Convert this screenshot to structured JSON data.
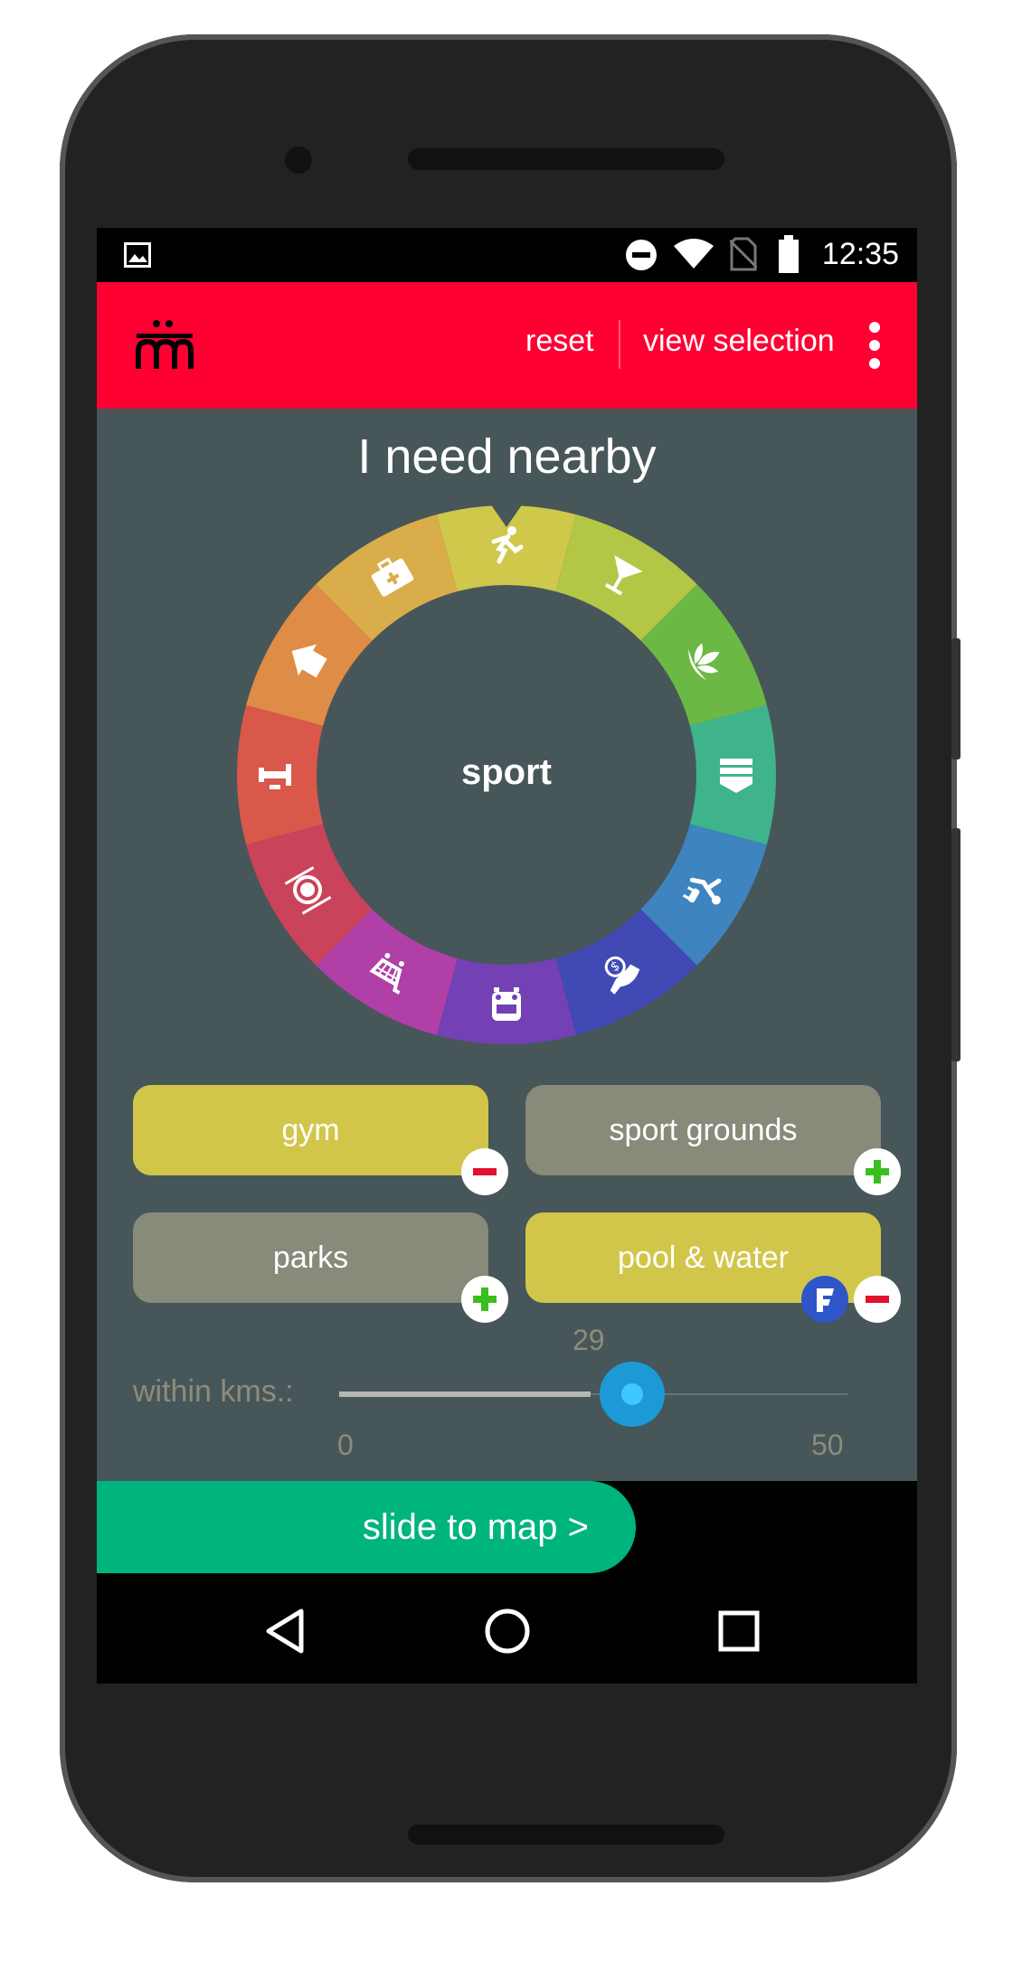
{
  "status_bar": {
    "time": "12:35",
    "icons": [
      "image-icon",
      "do-not-disturb-icon",
      "wifi-icon",
      "no-sim-icon",
      "battery-icon"
    ]
  },
  "app_bar": {
    "logo": "m-logo",
    "reset_label": "reset",
    "view_selection_label": "view selection",
    "more_icon": "more-vert-icon",
    "color": "#ff0033"
  },
  "heading": "I need nearby",
  "wheel": {
    "selected_label": "sport",
    "segments": [
      {
        "name": "sport",
        "icon": "runner-icon",
        "color": "#cfc84a",
        "selected": true
      },
      {
        "name": "drinks",
        "icon": "cocktail-icon",
        "color": "#b4c646"
      },
      {
        "name": "wellness",
        "icon": "lotus-icon",
        "color": "#6bb944"
      },
      {
        "name": "education",
        "icon": "books-icon",
        "color": "#3fb48c"
      },
      {
        "name": "pets",
        "icon": "dog-walker-icon",
        "color": "#3e84bf"
      },
      {
        "name": "money",
        "icon": "money-hand-icon",
        "color": "#4049b4"
      },
      {
        "name": "transport",
        "icon": "bus-icon",
        "color": "#7341b4"
      },
      {
        "name": "shopping",
        "icon": "cart-icon",
        "color": "#b03fa7"
      },
      {
        "name": "food",
        "icon": "plate-icon",
        "color": "#c9435a"
      },
      {
        "name": "fuel",
        "icon": "fuel-icon",
        "color": "#d9584a"
      },
      {
        "name": "home",
        "icon": "house-icon",
        "color": "#df8c46"
      },
      {
        "name": "health",
        "icon": "first-aid-icon",
        "color": "#d8ad4a"
      }
    ]
  },
  "chips": [
    {
      "label": "gym",
      "selected": true
    },
    {
      "label": "sport grounds",
      "selected": false
    },
    {
      "label": "parks",
      "selected": false
    },
    {
      "label": "pool & water",
      "selected": true,
      "foursquare": true
    }
  ],
  "slider": {
    "label": "within kms.:",
    "value": "29",
    "min": "0",
    "max": "50"
  },
  "map_button": {
    "label": "slide to map >",
    "color": "#00b47e"
  }
}
